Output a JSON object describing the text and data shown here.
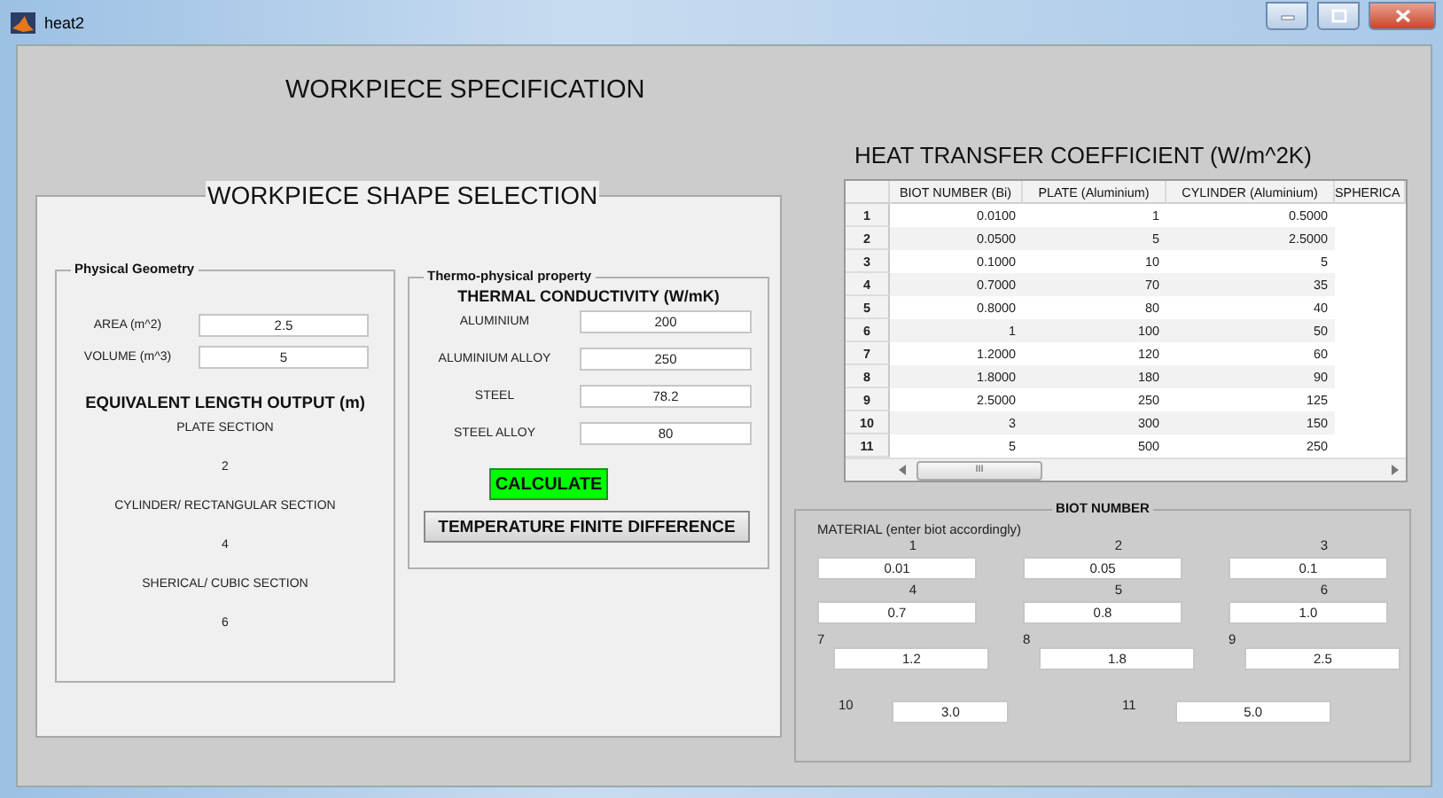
{
  "window": {
    "title": "heat2"
  },
  "heading": "WORKPIECE SPECIFICATION",
  "shape_panel": {
    "title": "WORKPIECE SHAPE SELECTION",
    "geometry": {
      "title": "Physical Geometry",
      "fields": [
        {
          "label": "AREA (m^2)",
          "value": "2.5"
        },
        {
          "label": "VOLUME (m^3)",
          "value": "5"
        }
      ],
      "output_title": "EQUIVALENT LENGTH OUTPUT (m)",
      "outputs": [
        {
          "label": "PLATE SECTION",
          "value": "2"
        },
        {
          "label": "CYLINDER/ RECTANGULAR SECTION",
          "value": "4"
        },
        {
          "label": "SHERICAL/ CUBIC SECTION",
          "value": "6"
        }
      ]
    },
    "thermo": {
      "title": "Thermo-physical property",
      "heading": "THERMAL CONDUCTIVITY (W/mK)",
      "fields": [
        {
          "label": "ALUMINIUM",
          "value": "200"
        },
        {
          "label": "ALUMINIUM ALLOY",
          "value": "250"
        },
        {
          "label": "STEEL",
          "value": "78.2"
        },
        {
          "label": "STEEL ALLOY",
          "value": "80"
        }
      ],
      "buttons": [
        {
          "label": "CALCULATE",
          "kind": "primary"
        },
        {
          "label": "TEMPERATURE FINITE DIFFERENCE",
          "kind": "normal"
        }
      ]
    }
  },
  "table": {
    "title": "HEAT TRANSFER COEFFICIENT (W/m^2K)",
    "columns": [
      "BIOT NUMBER (Bi)",
      "PLATE (Aluminium)",
      "CYLINDER (Aluminium)",
      "SPHERICA"
    ],
    "rows": [
      {
        "index": "1",
        "cells": [
          "0.0100",
          "1",
          "0.5000"
        ]
      },
      {
        "index": "2",
        "cells": [
          "0.0500",
          "5",
          "2.5000"
        ]
      },
      {
        "index": "3",
        "cells": [
          "0.1000",
          "10",
          "5"
        ]
      },
      {
        "index": "4",
        "cells": [
          "0.7000",
          "70",
          "35"
        ]
      },
      {
        "index": "5",
        "cells": [
          "0.8000",
          "80",
          "40"
        ]
      },
      {
        "index": "6",
        "cells": [
          "1",
          "100",
          "50"
        ]
      },
      {
        "index": "7",
        "cells": [
          "1.2000",
          "120",
          "60"
        ]
      },
      {
        "index": "8",
        "cells": [
          "1.8000",
          "180",
          "90"
        ]
      },
      {
        "index": "9",
        "cells": [
          "2.5000",
          "250",
          "125"
        ]
      },
      {
        "index": "10",
        "cells": [
          "3",
          "300",
          "150"
        ]
      },
      {
        "index": "11",
        "cells": [
          "5",
          "500",
          "250"
        ]
      }
    ],
    "scrollbar_grip": "III"
  },
  "biot": {
    "title": "BIOT NUMBER",
    "label": "MATERIAL (enter biot accordingly)",
    "fields": [
      {
        "label": "1",
        "value": "0.01",
        "kind": "stacked"
      },
      {
        "label": "2",
        "value": "0.05",
        "kind": "stacked"
      },
      {
        "label": "3",
        "value": "0.1",
        "kind": "stacked"
      },
      {
        "label": "4",
        "value": "0.7",
        "kind": "stacked"
      },
      {
        "label": "5",
        "value": "0.8",
        "kind": "stacked"
      },
      {
        "label": "6",
        "value": "1.0",
        "kind": "stacked"
      },
      {
        "label": "7",
        "value": "1.2",
        "kind": "raised"
      },
      {
        "label": "8",
        "value": "1.8",
        "kind": "raised"
      },
      {
        "label": "9",
        "value": "2.5",
        "kind": "raised"
      },
      {
        "label": "10",
        "value": "3.0",
        "kind": "inline"
      },
      {
        "label": "11",
        "value": "5.0",
        "kind": "inline"
      }
    ]
  }
}
